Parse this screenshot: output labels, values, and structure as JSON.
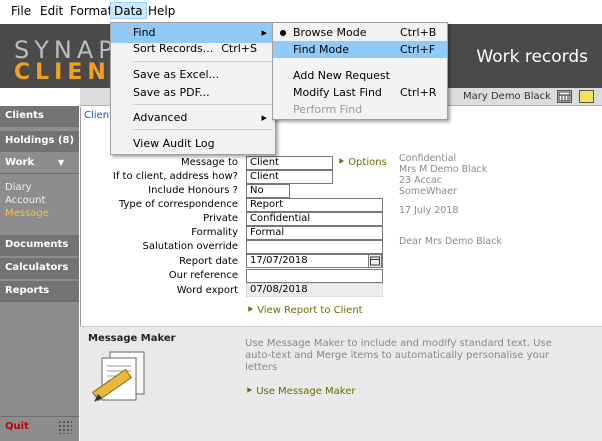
{
  "menubar": {
    "items": [
      {
        "label": "File"
      },
      {
        "label": "Edit"
      },
      {
        "label": "Format"
      },
      {
        "label": "Data"
      },
      {
        "label": "Help"
      }
    ]
  },
  "header": {
    "logo_top": "SYNAP",
    "logo_bottom": "CLIENT",
    "title": "Work records",
    "user": "Mary Demo Black"
  },
  "sidebar": {
    "clients": "Clients",
    "holdings": "Holdings (8)",
    "work": "Work",
    "work_items": [
      "Diary",
      "Account",
      "Message"
    ],
    "documents": "Documents",
    "calculators": "Calculators",
    "reports": "Reports",
    "quit": "Quit"
  },
  "breadcrumb": "Client",
  "form": {
    "fields": [
      {
        "label": "Message to",
        "value": "Client"
      },
      {
        "label": "If to client, address how?",
        "value": "Client"
      },
      {
        "label": "Include Honours ?",
        "value": "No"
      },
      {
        "label": "Type of correspondence",
        "value": "Report"
      },
      {
        "label": "Private",
        "value": "Confidential"
      },
      {
        "label": "Formality",
        "value": "Formal"
      },
      {
        "label": "Salutation override",
        "value": ""
      },
      {
        "label": "Report date",
        "value": "17/07/2018"
      },
      {
        "label": "Our reference",
        "value": ""
      },
      {
        "label": "Word export",
        "value": "07/08/2018"
      }
    ],
    "options_link": "Options",
    "view_link": "View Report to Client"
  },
  "preview": {
    "lines": [
      "Confidential",
      "Mrs M Demo Black",
      "23 Accac",
      "SomeWhaer"
    ],
    "date": "17 July 2018",
    "salutation": "Dear Mrs Demo Black"
  },
  "message_maker": {
    "title": "Message Maker",
    "desc": "Use Message Maker to include and modify standard text. Use auto-text and Merge items to automatically personalise your letters",
    "link": "Use Message Maker"
  },
  "data_menu": {
    "items": [
      {
        "label": "Find",
        "shortcut": "",
        "submenu": true
      },
      {
        "label": "Sort Records...",
        "shortcut": "Ctrl+S"
      },
      {
        "label": "Save as Excel...",
        "shortcut": ""
      },
      {
        "label": "Save as PDF...",
        "shortcut": ""
      },
      {
        "label": "Advanced",
        "shortcut": "",
        "submenu": true
      },
      {
        "label": "View Audit Log",
        "shortcut": ""
      }
    ]
  },
  "find_menu": {
    "items": [
      {
        "label": "Browse Mode",
        "shortcut": "Ctrl+B",
        "checked": true
      },
      {
        "label": "Find Mode",
        "shortcut": "Ctrl+F"
      },
      {
        "label": "Add New Request",
        "shortcut": ""
      },
      {
        "label": "Modify Last Find",
        "shortcut": "Ctrl+R"
      },
      {
        "label": "Perform Find",
        "shortcut": "",
        "disabled": true
      }
    ]
  },
  "colors": {
    "accent_orange": "#f2a020",
    "menu_highlight": "#91c9f7",
    "link_olive": "#6b6b00",
    "quit_red": "#c00000"
  }
}
